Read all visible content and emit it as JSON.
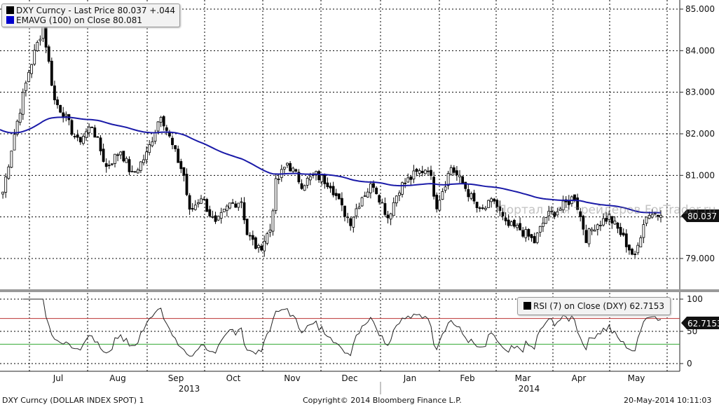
{
  "legend_main": {
    "line1": "DXY Curncy - Last Price 80.037  +.044",
    "line2": "EMAVG (100) on Close    80.081",
    "colors": {
      "price": "#000000",
      "ema": "#0000cc"
    }
  },
  "legend_rsi": {
    "label": "RSI (7) on Close (DXY) 62.7153"
  },
  "tags": {
    "price": "80.037",
    "rsi": "62.7153"
  },
  "watermark": "Портал для трейдеров ForTrader.ru",
  "footer": {
    "left": "DXY Curncy (DOLLAR INDEX SPOT) 1",
    "center": "Copyright© 2014 Bloomberg Finance L.P.",
    "right": "20-May-2014 10:11:03"
  },
  "chart_data": {
    "type": "candlestick",
    "title": "DXY Curncy - Last Price",
    "y_ticks": [
      "85.000",
      "84.000",
      "83.000",
      "82.000",
      "81.000",
      "80.000",
      "79.000"
    ],
    "ylim": [
      78.3,
      85.2
    ],
    "x_ticks": [
      "Jul",
      "Aug",
      "Sep",
      "Oct",
      "Nov",
      "Dec",
      "Jan",
      "Feb",
      "Mar",
      "Apr",
      "May"
    ],
    "years": [
      "2013",
      "2014"
    ],
    "ema_period": 100,
    "ema_seed": 82.1,
    "key_closes": [
      [
        1,
        80.6
      ],
      [
        5,
        82.0
      ],
      [
        10,
        83.5
      ],
      [
        15,
        84.6
      ],
      [
        19,
        82.8
      ],
      [
        22,
        82.5
      ],
      [
        27,
        81.8
      ],
      [
        32,
        82.2
      ],
      [
        37,
        81.2
      ],
      [
        42,
        81.6
      ],
      [
        46,
        81.0
      ],
      [
        51,
        81.5
      ],
      [
        56,
        82.5
      ],
      [
        60,
        81.7
      ],
      [
        64,
        81.0
      ],
      [
        66,
        80.1
      ],
      [
        70,
        80.5
      ],
      [
        75,
        79.8
      ],
      [
        80,
        80.3
      ],
      [
        84,
        80.4
      ],
      [
        86,
        79.6
      ],
      [
        90,
        79.2
      ],
      [
        94,
        79.7
      ],
      [
        96,
        80.8
      ],
      [
        100,
        81.3
      ],
      [
        105,
        80.8
      ],
      [
        110,
        81.0
      ],
      [
        115,
        80.8
      ],
      [
        119,
        80.2
      ],
      [
        122,
        79.9
      ],
      [
        126,
        80.5
      ],
      [
        130,
        80.8
      ],
      [
        135,
        80.0
      ],
      [
        139,
        80.7
      ],
      [
        144,
        81.0
      ],
      [
        149,
        81.2
      ],
      [
        152,
        80.3
      ],
      [
        157,
        81.2
      ],
      [
        162,
        80.7
      ],
      [
        167,
        80.1
      ],
      [
        172,
        80.4
      ],
      [
        176,
        79.8
      ],
      [
        181,
        79.7
      ],
      [
        186,
        79.4
      ],
      [
        190,
        80.0
      ],
      [
        195,
        80.2
      ],
      [
        200,
        80.5
      ],
      [
        204,
        79.5
      ],
      [
        207,
        79.8
      ],
      [
        212,
        80.0
      ],
      [
        216,
        79.6
      ],
      [
        221,
        79.0
      ],
      [
        224,
        79.9
      ],
      [
        226,
        80.1
      ],
      [
        230,
        80.04
      ]
    ],
    "rsi": {
      "period": 7,
      "levels": [
        70,
        30
      ],
      "y_ticks": [
        "100",
        "50",
        "0"
      ],
      "ylim": [
        0,
        100
      ],
      "last": 62.7153
    }
  }
}
